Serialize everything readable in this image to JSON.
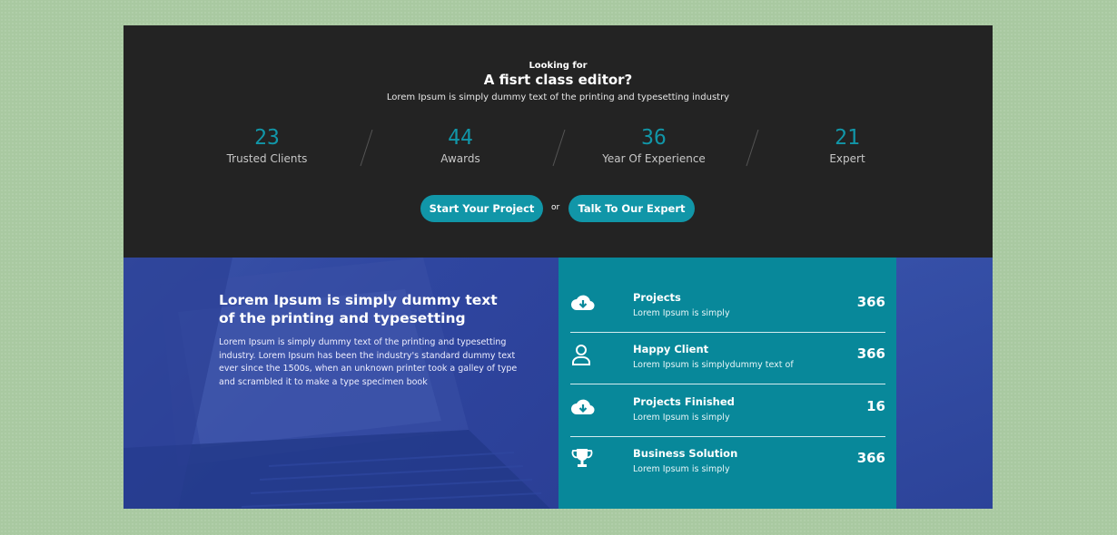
{
  "hero": {
    "eyebrow": "Looking for",
    "title": "A fisrt class editor?",
    "subtitle": "Lorem Ipsum is simply dummy text of the printing and typesetting industry"
  },
  "stats": [
    {
      "value": "23",
      "label": "Trusted Clients"
    },
    {
      "value": "44",
      "label": "Awards"
    },
    {
      "value": "36",
      "label": "Year Of Experience"
    },
    {
      "value": "21",
      "label": "Expert"
    }
  ],
  "cta": {
    "primary": "Start Your Project",
    "or": "or",
    "secondary": "Talk To Our Expert"
  },
  "about": {
    "heading": "Lorem Ipsum is simply dummy text of the printing and typesetting",
    "body": "Lorem Ipsum is simply dummy text of the printing and typesetting industry. Lorem Ipsum has been the industry's standard dummy text ever since the 1500s, when an unknown printer took a galley of type and scrambled it to make a type specimen book"
  },
  "features": [
    {
      "icon": "cloud-download-icon",
      "title": "Projects",
      "subtitle": "Lorem Ipsum is simply",
      "value": "366"
    },
    {
      "icon": "user-icon",
      "title": "Happy Client",
      "subtitle": "Lorem Ipsum is simplydummy text of",
      "value": "366"
    },
    {
      "icon": "cloud-download-icon",
      "title": "Projects Finished",
      "subtitle": "Lorem Ipsum is simply",
      "value": "16"
    },
    {
      "icon": "trophy-icon",
      "title": "Business Solution",
      "subtitle": "Lorem Ipsum is simply",
      "value": "366"
    }
  ],
  "colors": {
    "accent": "#1196a8",
    "dark": "#232323",
    "panel_teal": "#08889a",
    "panel_blue": "#2f46a0"
  }
}
